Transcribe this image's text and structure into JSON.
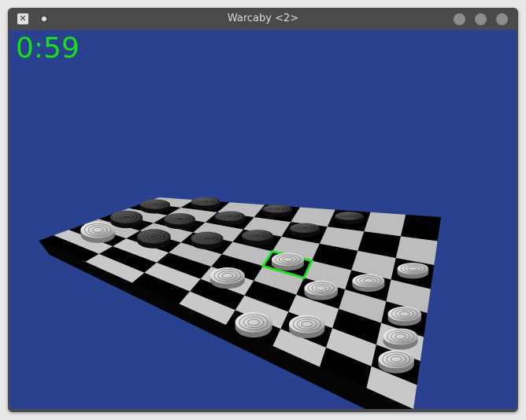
{
  "window": {
    "title": "Warcaby <2>"
  },
  "game": {
    "timer": "0:59",
    "selection_color": "#1fe01f",
    "colors": {
      "background": "#29418f",
      "timer_text": "#16e016",
      "light_square": "#bdbdbd",
      "dark_square": "#000000",
      "white_piece": "#d9d9d9",
      "black_piece": "#2c2c2c"
    }
  }
}
